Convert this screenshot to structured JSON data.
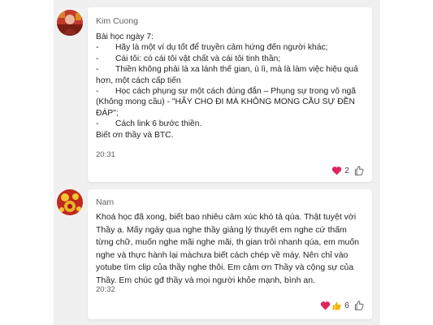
{
  "messages": [
    {
      "sender": "Kim Cuong",
      "heading": "Bài học ngày 7:",
      "bullets": [
        {
          "dash": "-",
          "text": "Hãy là một ví dụ tốt để truyền cảm hứng đến người khác;"
        },
        {
          "dash": "-",
          "text": "Cái tôi: có cái tôi vật chất và cái tôi tinh thần;"
        },
        {
          "dash": "-",
          "text": "Thiền không phải là xa lánh thế gian, ù lì, mà là làm việc hiệu quả",
          "cont": "hơn, một cách cấp tiến"
        },
        {
          "dash": "-",
          "text": "Học cách phụng sự một cách đúng đắn – Phụng sự trong vô ngã",
          "cont": "(Không mong cầu) - \"HÃY CHO ĐI MÀ KHÔNG MONG CẦU SỰ ĐỀN",
          "cont2": "ĐÁP\";"
        },
        {
          "dash": "-",
          "text": "Cách link 6 bước thiền."
        }
      ],
      "closing": "Biết ơn thầy và BTC.",
      "time": "20:31",
      "reaction_count": "2",
      "reaction_icons": [
        "heart-icon"
      ]
    },
    {
      "sender": "Nam",
      "lines": [
        "Khoá học đã xong, biết bao nhiêu cảm xúc khó tả qúa. Thật tuyệt vời",
        "Thầy ạ. Mấy ngày qua nghe thầy giảng lý thuyết em nghe cứ thấm",
        "từng chữ, muốn nghe mãi nghe mãi, th gian trôi nhanh qúa, em muốn",
        "nghe và thực hành lại màchưa biết cách chép về máy. Nên chỉ vào",
        "yotube tìm clip của thầy nghe thôi. Em cảm ơn Thầy và cộng sự của",
        "Thầy. Em chúc gđ thầy và mọi người khỏe mạnh, bình an."
      ],
      "time": "20:32",
      "reaction_count": "6",
      "reaction_icons": [
        "heart-icon",
        "thumbs-up-icon"
      ]
    }
  ],
  "colors": {
    "feed_bg": "#f0f0f0",
    "card_bg": "#ffffff",
    "heart": "#e0245e",
    "thumb": "#f4b400"
  }
}
